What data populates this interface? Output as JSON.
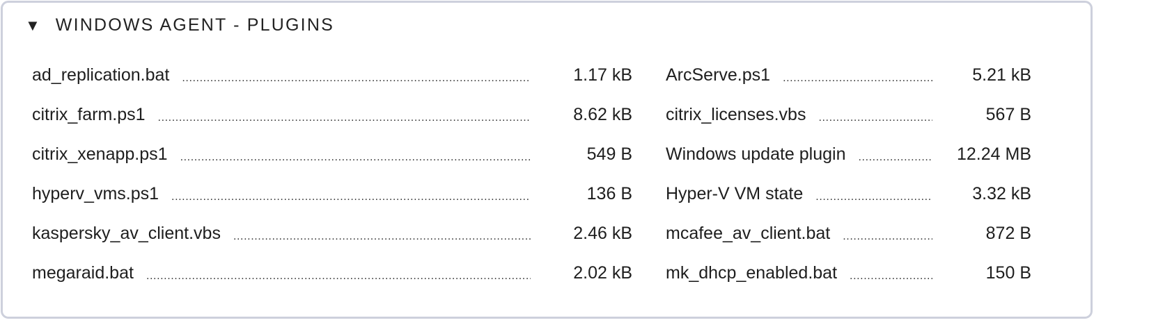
{
  "section": {
    "title": "WINDOWS AGENT - PLUGINS",
    "expanded": true,
    "toggle_icon": "triangle-down-icon"
  },
  "columns": [
    [
      {
        "name": "ad_replication.bat",
        "size": "1.17 kB"
      },
      {
        "name": "citrix_farm.ps1",
        "size": "8.62 kB"
      },
      {
        "name": "citrix_xenapp.ps1",
        "size": "549 B"
      },
      {
        "name": "hyperv_vms.ps1",
        "size": "136 B"
      },
      {
        "name": "kaspersky_av_client.vbs",
        "size": "2.46 kB"
      },
      {
        "name": "megaraid.bat",
        "size": "2.02 kB"
      }
    ],
    [
      {
        "name": "ArcServe.ps1",
        "size": "5.21 kB"
      },
      {
        "name": "citrix_licenses.vbs",
        "size": "567 B"
      },
      {
        "name": "Windows update plugin",
        "size": "12.24 MB"
      },
      {
        "name": "Hyper-V VM state",
        "size": "3.32 kB"
      },
      {
        "name": "mcafee_av_client.bat",
        "size": "872 B"
      },
      {
        "name": "mk_dhcp_enabled.bat",
        "size": "150 B"
      }
    ]
  ]
}
